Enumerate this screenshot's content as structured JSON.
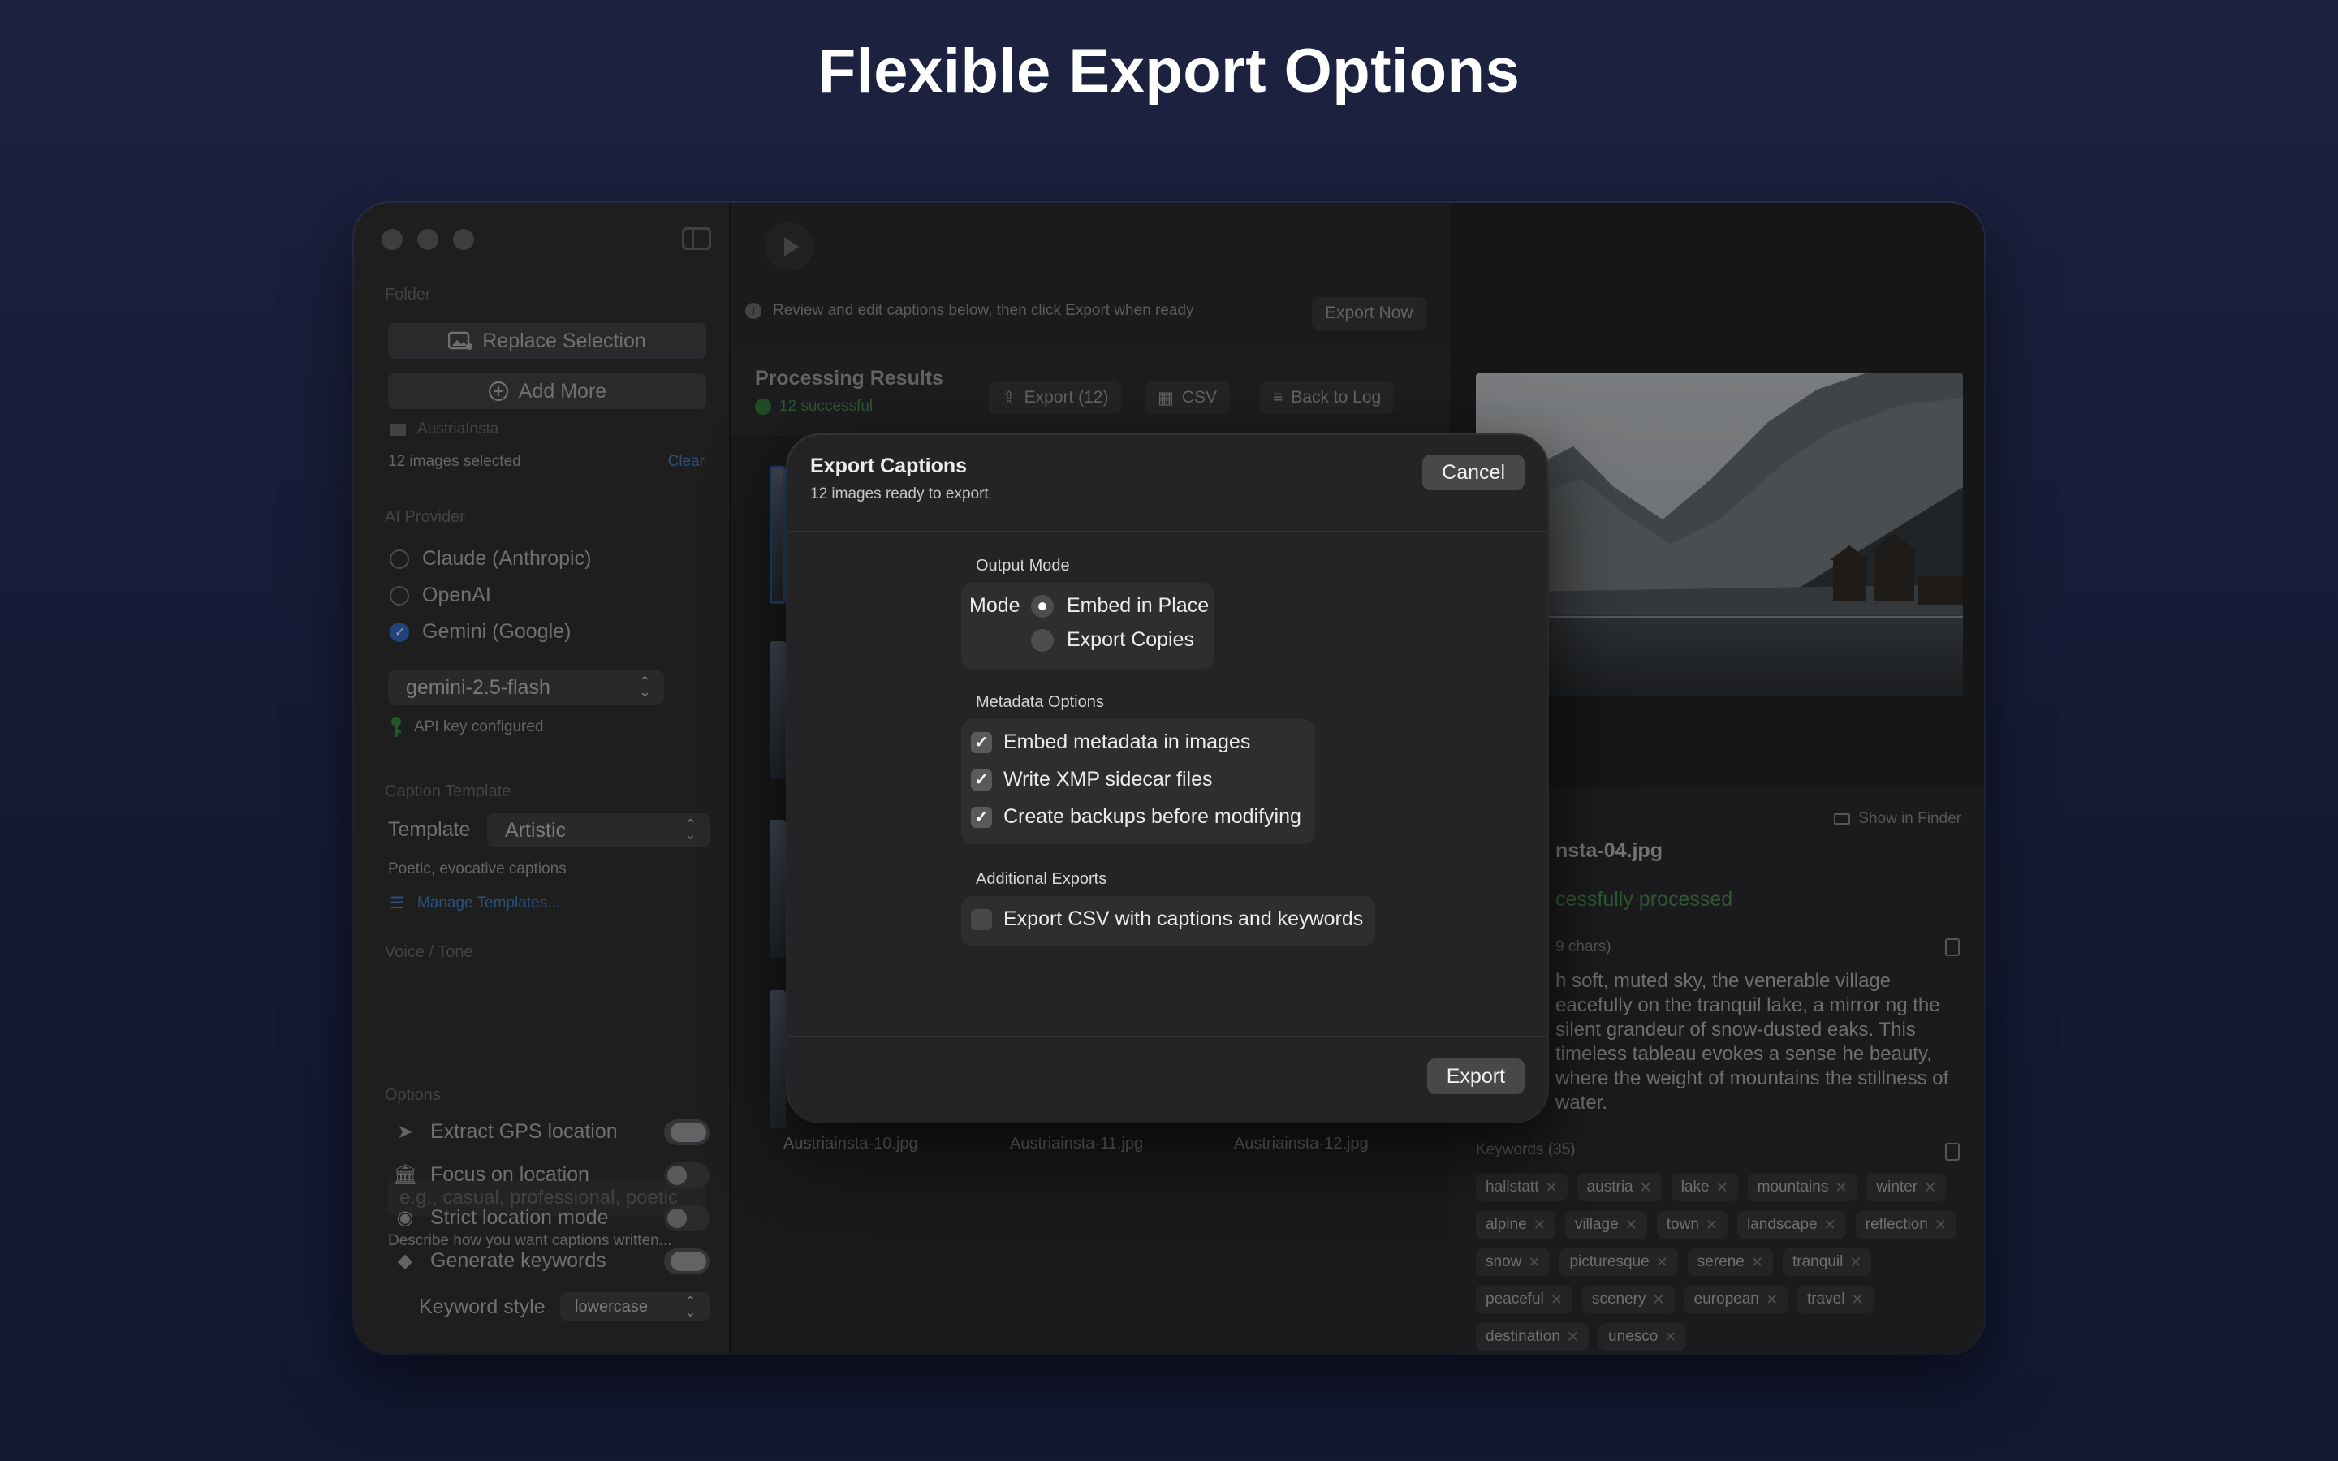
{
  "headline": "Flexible Export Options",
  "sidebar": {
    "folder_label": "Folder",
    "replace_selection": "Replace Selection",
    "add_more": "Add More",
    "folder_name": "AustriaInsta",
    "images_selected": "12 images selected",
    "clear": "Clear",
    "ai_provider_label": "AI Provider",
    "providers": [
      {
        "label": "Claude (Anthropic)",
        "selected": false
      },
      {
        "label": "OpenAI",
        "selected": false
      },
      {
        "label": "Gemini (Google)",
        "selected": true
      }
    ],
    "model": "gemini-2.5-flash",
    "api_key_status": "API key configured",
    "caption_template_label": "Caption Template",
    "template_label": "Template",
    "template_value": "Artistic",
    "template_desc": "Poetic, evocative captions",
    "manage_templates": "Manage Templates...",
    "voice_tone_label": "Voice / Tone",
    "voice_placeholder": "e.g., casual, professional, poetic",
    "voice_desc": "Describe how you want captions written...",
    "options_label": "Options",
    "options": [
      {
        "label": "Extract GPS location",
        "icon": "location-arrow-icon",
        "on": true
      },
      {
        "label": "Focus on location",
        "icon": "landmark-icon",
        "on": false
      },
      {
        "label": "Strict location mode",
        "icon": "eye-slash-icon",
        "on": false
      },
      {
        "label": "Generate keywords",
        "icon": "tag-icon",
        "on": true
      }
    ],
    "keyword_style_label": "Keyword style",
    "keyword_style_value": "lowercase"
  },
  "middle": {
    "info_text": "Review and edit captions below, then click Export when ready",
    "export_now": "Export Now",
    "results_title": "Processing Results",
    "results_sub": "12 successful",
    "export_btn": "Export (12)",
    "csv_btn": "CSV",
    "back_btn": "Back to Log",
    "thumb_captions": [
      "Austriainsta-10.jpg",
      "Austriainsta-11.jpg",
      "Austriainsta-12.jpg"
    ]
  },
  "right": {
    "show_in_finder": "Show in Finder",
    "file_title": "nsta-04.jpg",
    "status": "cessfully processed",
    "chars_label": "9 chars)",
    "caption": "h soft, muted sky, the venerable village eacefully on the tranquil lake, a mirror ng the silent grandeur of snow-dusted eaks. This timeless tableau evokes a sense he beauty, where the weight of mountains the stillness of water.",
    "keywords_label": "Keywords (35)",
    "keywords": [
      "hallstatt",
      "austria",
      "lake",
      "mountains",
      "winter",
      "alpine",
      "village",
      "town",
      "landscape",
      "reflection",
      "snow",
      "picturesque",
      "serene",
      "tranquil",
      "peaceful",
      "scenery",
      "european",
      "travel",
      "destination",
      "unesco"
    ]
  },
  "modal": {
    "title": "Export Captions",
    "subtitle": "12 images ready to export",
    "cancel": "Cancel",
    "output_mode_label": "Output Mode",
    "mode_label": "Mode",
    "modes": [
      {
        "label": "Embed in Place",
        "selected": true
      },
      {
        "label": "Export Copies",
        "selected": false
      }
    ],
    "metadata_label": "Metadata Options",
    "metadata": [
      {
        "label": "Embed metadata in images",
        "checked": true
      },
      {
        "label": "Write XMP sidecar files",
        "checked": true
      },
      {
        "label": "Create backups before modifying",
        "checked": true
      }
    ],
    "additional_label": "Additional Exports",
    "additional": [
      {
        "label": "Export CSV with captions and keywords",
        "checked": false
      }
    ],
    "export": "Export"
  }
}
